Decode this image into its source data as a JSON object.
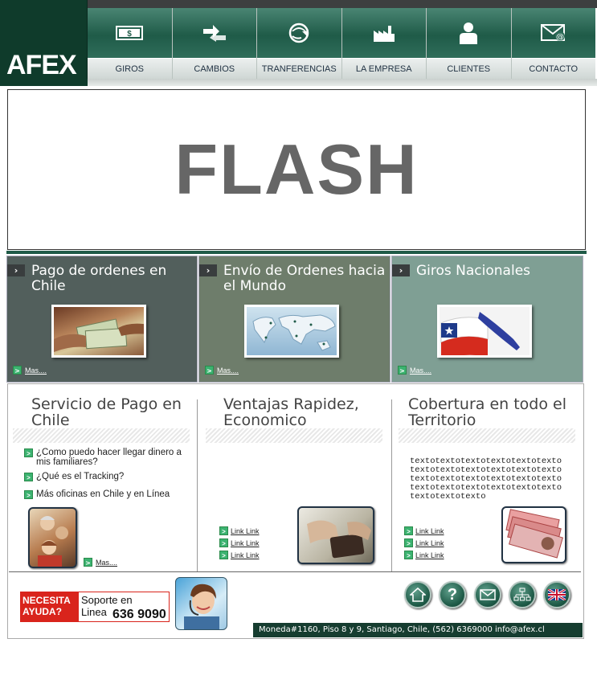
{
  "brand": {
    "logo_text": "AFEX"
  },
  "nav": [
    {
      "label": "GIROS",
      "icon": "dollar-bill-icon"
    },
    {
      "label": "CAMBIOS",
      "icon": "exchange-arrows-icon"
    },
    {
      "label": "TRANFERENCIAS",
      "icon": "globe-arrow-icon"
    },
    {
      "label": "LA EMPRESA",
      "icon": "factory-icon"
    },
    {
      "label": "CLIENTES",
      "icon": "person-icon"
    },
    {
      "label": "CONTACTO",
      "icon": "envelope-at-icon"
    }
  ],
  "flash": {
    "text": "FLASH"
  },
  "promos": [
    {
      "title": "Pago de ordenes en Chile",
      "more": "Mas....",
      "bg": "#525f5c"
    },
    {
      "title": "Envío de Ordenes hacia el Mundo",
      "more": "Mas....",
      "bg": "#6e7d6b"
    },
    {
      "title": "Giros Nacionales",
      "more": "Mas....",
      "bg": "#7f9f94"
    }
  ],
  "info": {
    "col1": {
      "title": "Servicio de Pago en Chile",
      "questions": [
        "¿Como puedo hacer llegar dinero a mis familiares?",
        "¿Qué es el Tracking?",
        "Más oficinas en Chile y en Línea"
      ],
      "more": "Mas...."
    },
    "col2": {
      "title": "Ventajas Rapidez, Economico",
      "links": [
        "Link Link",
        "Link Link",
        "Link Link"
      ]
    },
    "col3": {
      "title": "Cobertura en todo el Territorio",
      "filler": "textotextotextotextotextotextotextotextotextotextotextotextotextotextotextotextotextotextotextotextotextotextotextotextotextotextotexto",
      "links": [
        "Link Link",
        "Link Link",
        "Link Link"
      ]
    }
  },
  "help": {
    "badge": "NECESITA AYUDA?",
    "support": "Soporte en Linea",
    "phone": "636 9090"
  },
  "footer_icons": [
    "home-icon",
    "help-icon",
    "mail-icon",
    "sitemap-icon",
    "uk-flag-icon"
  ],
  "footer": {
    "address": "Moneda#1160, Piso 8 y 9, Santiago, Chile, (562) 6369000 info@afex.cl"
  },
  "colors": {
    "brand_green": "#1f5b48",
    "dark_green": "#0f3b2b",
    "red": "#d9241c"
  }
}
